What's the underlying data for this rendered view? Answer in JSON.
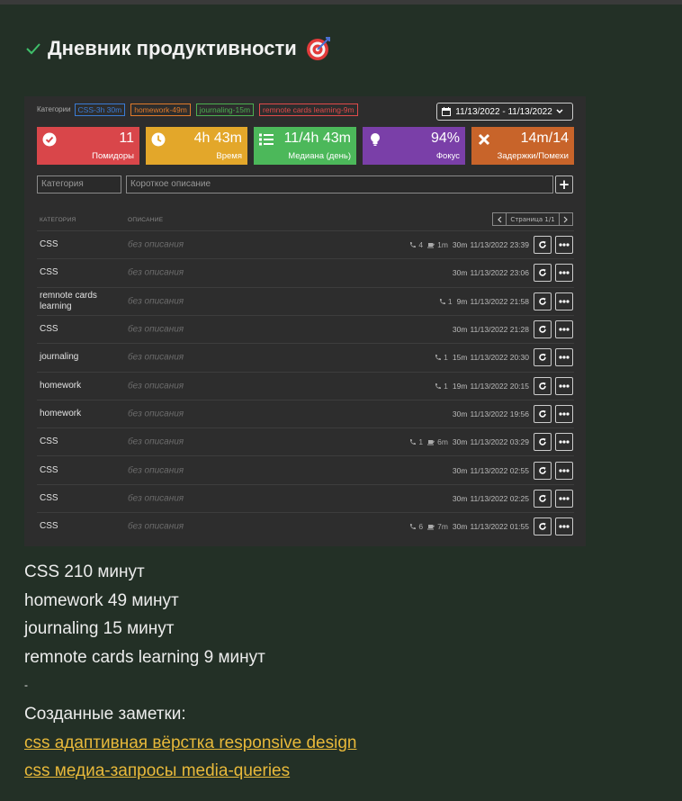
{
  "heading": {
    "title": "Дневник продуктивности"
  },
  "app": {
    "categories_label": "Категории",
    "chips": [
      {
        "label": "CSS-3h 30m",
        "color": "#3a7bd5"
      },
      {
        "label": "homework-49m",
        "color": "#e07a2a"
      },
      {
        "label": "journaling-15m",
        "color": "#4caf50"
      },
      {
        "label": "remnote cards learning-9m",
        "color": "#e04a4a"
      }
    ],
    "date_range": "11/13/2022 - 11/13/2022",
    "stats": [
      {
        "value": "11",
        "label": "Помидоры",
        "color": "#d9464a",
        "icon": "check-circle-icon"
      },
      {
        "value": "4h 43m",
        "label": "Время",
        "color": "#e3a72a",
        "icon": "clock-icon"
      },
      {
        "value": "11/4h 43m",
        "label": "Медиана (день)",
        "color": "#4cb85a",
        "icon": "list-icon"
      },
      {
        "value": "94%",
        "label": "Фокус",
        "color": "#7a3fa8",
        "icon": "lightbulb-icon"
      },
      {
        "value": "14m/14",
        "label": "Задержки/Помехи",
        "color": "#c8642a",
        "icon": "close-icon"
      }
    ],
    "category_placeholder": "Категория",
    "description_placeholder": "Короткое описание",
    "add_label": "+",
    "table": {
      "col_category": "КАТЕГОРИЯ",
      "col_description": "ОПИСАНИЕ",
      "page_label": "Страница 1/1",
      "rows": [
        {
          "category": "CSS",
          "description": "без описания",
          "calls": "4",
          "breaks": "1m",
          "duration": "30m",
          "time": "11/13/2022 23:39"
        },
        {
          "category": "CSS",
          "description": "без описания",
          "calls": "",
          "breaks": "",
          "duration": "30m",
          "time": "11/13/2022 23:06"
        },
        {
          "category": "remnote cards learning",
          "description": "без описания",
          "calls": "1",
          "breaks": "",
          "duration": "9m",
          "time": "11/13/2022 21:58"
        },
        {
          "category": "CSS",
          "description": "без описания",
          "calls": "",
          "breaks": "",
          "duration": "30m",
          "time": "11/13/2022 21:28"
        },
        {
          "category": "journaling",
          "description": "без описания",
          "calls": "1",
          "breaks": "",
          "duration": "15m",
          "time": "11/13/2022 20:30"
        },
        {
          "category": "homework",
          "description": "без описания",
          "calls": "1",
          "breaks": "",
          "duration": "19m",
          "time": "11/13/2022 20:15"
        },
        {
          "category": "homework",
          "description": "без описания",
          "calls": "",
          "breaks": "",
          "duration": "30m",
          "time": "11/13/2022 19:56"
        },
        {
          "category": "CSS",
          "description": "без описания",
          "calls": "1",
          "breaks": "6m",
          "duration": "30m",
          "time": "11/13/2022 03:29"
        },
        {
          "category": "CSS",
          "description": "без описания",
          "calls": "",
          "breaks": "",
          "duration": "30m",
          "time": "11/13/2022 02:55"
        },
        {
          "category": "CSS",
          "description": "без описания",
          "calls": "",
          "breaks": "",
          "duration": "30m",
          "time": "11/13/2022 02:25"
        },
        {
          "category": "CSS",
          "description": "без описания",
          "calls": "6",
          "breaks": "7m",
          "duration": "30m",
          "time": "11/13/2022 01:55"
        }
      ]
    }
  },
  "summary": {
    "lines": [
      "CSS 210 минут",
      "homework 49 минут",
      "journaling 15 минут",
      "remnote cards learning 9 минут"
    ],
    "dot": "-",
    "notes_label": "Созданные заметки:",
    "links": [
      "css адаптивная вёрстка responsive design",
      "css медиа-запросы media-queries"
    ]
  },
  "colors": {
    "background": "#233026",
    "panel": "#2d2d2d",
    "link": "#e8b93a"
  }
}
